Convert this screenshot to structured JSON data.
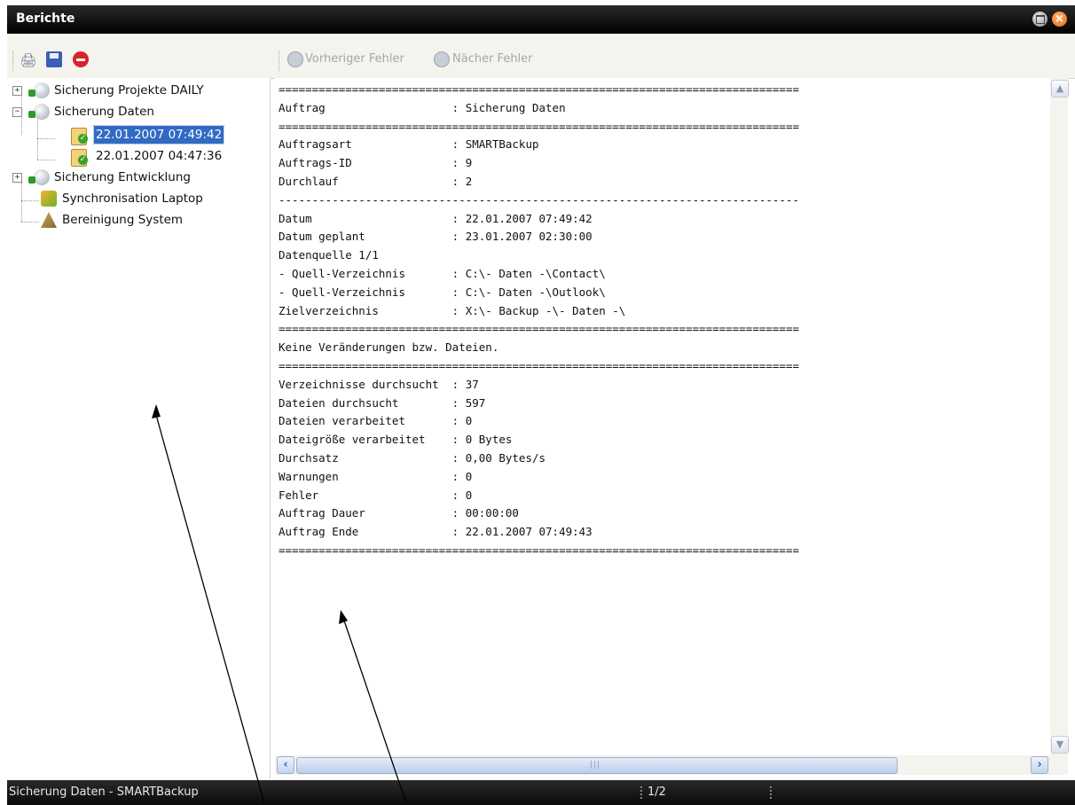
{
  "window": {
    "title": "Berichte"
  },
  "toolbar": {
    "prev_error": "Vorheriger Fehler",
    "next_error": "Nächer Fehler"
  },
  "tree": {
    "items": [
      {
        "label": "Sicherung Projekte DAILY",
        "expander": "+"
      },
      {
        "label": "Sicherung Daten",
        "expander": "−"
      },
      {
        "label": "22.01.2007 07:49:42"
      },
      {
        "label": "22.01.2007 04:47:36"
      },
      {
        "label": "Sicherung Entwicklung",
        "expander": "+"
      },
      {
        "label": "Synchronisation Laptop"
      },
      {
        "label": "Bereinigung System"
      }
    ],
    "selected": "22.01.2007 07:49:42"
  },
  "report": {
    "lines": [
      "==============================================================================",
      "Auftrag                   : Sicherung Daten",
      "==============================================================================",
      "Auftragsart               : SMARTBackup",
      "Auftrags-ID               : 9",
      "Durchlauf                 : 2",
      "------------------------------------------------------------------------------",
      "Datum                     : 22.01.2007 07:49:42",
      "Datum geplant             : 23.01.2007 02:30:00",
      "Datenquelle 1/1",
      "- Quell-Verzeichnis       : C:\\- Daten -\\Contact\\",
      "- Quell-Verzeichnis       : C:\\- Daten -\\Outlook\\",
      "Zielverzeichnis           : X:\\- Backup -\\- Daten -\\",
      "==============================================================================",
      "Keine Veränderungen bzw. Dateien.",
      "==============================================================================",
      "Verzeichnisse durchsucht  : 37",
      "Dateien durchsucht        : 597",
      "Dateien verarbeitet       : 0",
      "Dateigröße verarbeitet    : 0 Bytes",
      "Durchsatz                 : 0,00 Bytes/s",
      "Warnungen                 : 0",
      "Fehler                    : 0",
      "Auftrag Dauer             : 00:00:00",
      "Auftrag Ende              : 22.01.2007 07:49:43",
      "=============================================================================="
    ]
  },
  "scrollbar": {
    "thumb_grip": "|||"
  },
  "status": {
    "job": "Sicherung Daten - SMARTBackup",
    "page": "1/2"
  },
  "colors": {
    "selection": "#316ac5",
    "titlebar": "#111111",
    "accent_close": "#e86a10"
  }
}
